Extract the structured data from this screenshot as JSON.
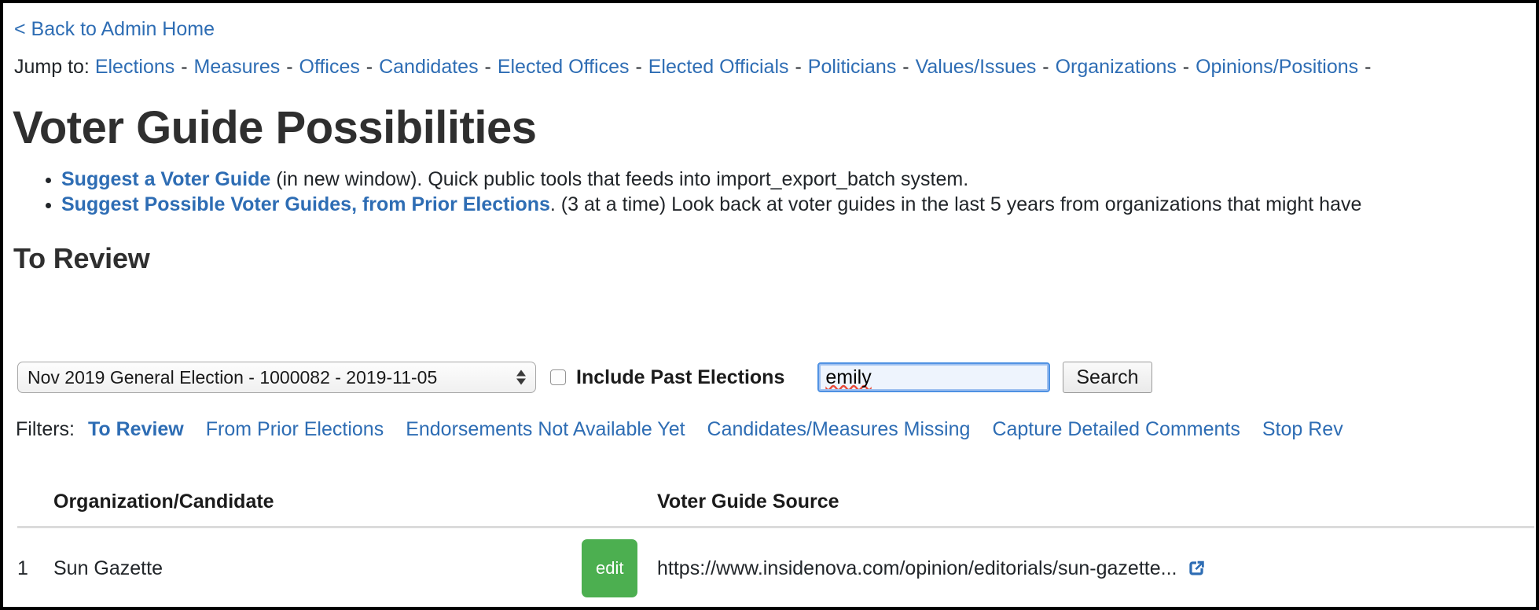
{
  "header": {
    "back_link": "< Back to Admin Home"
  },
  "jump_to": {
    "label": "Jump to:",
    "separator": "-",
    "links": [
      "Elections",
      "Measures",
      "Offices",
      "Candidates",
      "Elected Offices",
      "Elected Officials",
      "Politicians",
      "Values/Issues",
      "Organizations",
      "Opinions/Positions"
    ],
    "trailing_separator": "-"
  },
  "page_title": "Voter Guide Possibilities",
  "bullets": [
    {
      "link": "Suggest a Voter Guide",
      "text": " (in new window). Quick public tools that feeds into import_export_batch system."
    },
    {
      "link": "Suggest Possible Voter Guides, from Prior Elections",
      "text": ". (3 at a time) Look back at voter guides in the last 5 years from organizations that might have"
    }
  ],
  "section_title": "To Review",
  "controls": {
    "election_select": {
      "selected": "Nov 2019 General Election - 1000082 - 2019-11-05",
      "options": [
        "Nov 2019 General Election - 1000082 - 2019-11-05"
      ]
    },
    "include_past_elections": {
      "label": "Include Past Elections",
      "checked": false
    },
    "search_input": {
      "value": "emily",
      "placeholder": ""
    },
    "search_button": "Search"
  },
  "filters": {
    "label": "Filters:",
    "items": [
      {
        "label": "To Review",
        "active": true
      },
      {
        "label": "From Prior Elections",
        "active": false
      },
      {
        "label": "Endorsements Not Available Yet",
        "active": false
      },
      {
        "label": "Candidates/Measures Missing",
        "active": false
      },
      {
        "label": "Capture Detailed Comments",
        "active": false
      },
      {
        "label": "Stop Rev",
        "active": false
      }
    ]
  },
  "table": {
    "columns": [
      "",
      "Organization/Candidate",
      "",
      "Voter Guide Source"
    ],
    "rows": [
      {
        "num": "1",
        "organization": "Sun Gazette",
        "edit_label": "edit",
        "source_url": "https://www.insidenova.com/opinion/editorials/sun-gazette...",
        "external_icon": "external-link-icon"
      }
    ]
  },
  "colors": {
    "link": "#2e6db4",
    "edit_button": "#4caf50",
    "focus_ring": "#4a90e2",
    "spellcheck_underline": "#e74c3c"
  }
}
